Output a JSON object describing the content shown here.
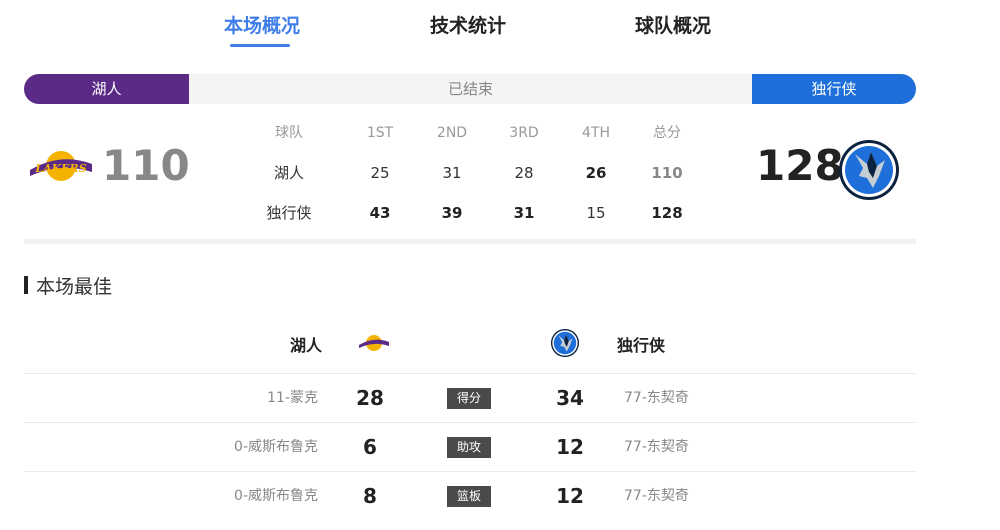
{
  "tabs": [
    {
      "label": "本场概况",
      "active": true
    },
    {
      "label": "技术统计",
      "active": false
    },
    {
      "label": "球队概况",
      "active": false
    }
  ],
  "status_bar": {
    "home_team": "湖人",
    "status": "已结束",
    "away_team": "独行侠",
    "home_color": "#5b2a86",
    "away_color": "#1e6fd9"
  },
  "score": {
    "home_score": "110",
    "away_score": "128",
    "home_logo": "lakers-logo",
    "away_logo": "mavericks-logo"
  },
  "quarters": {
    "headers": [
      "球队",
      "1ST",
      "2ND",
      "3RD",
      "4TH",
      "总分"
    ],
    "rows": [
      {
        "team": "湖人",
        "values": [
          "25",
          "31",
          "28",
          "26",
          "110"
        ]
      },
      {
        "team": "独行侠",
        "values": [
          "43",
          "39",
          "31",
          "15",
          "128"
        ]
      }
    ]
  },
  "best": {
    "title": "本场最佳",
    "home_team": "湖人",
    "away_team": "独行侠",
    "rows": [
      {
        "home_player": "11-蒙克",
        "home_value": "28",
        "category": "得分",
        "away_value": "34",
        "away_player": "77-东契奇"
      },
      {
        "home_player": "0-威斯布鲁克",
        "home_value": "6",
        "category": "助攻",
        "away_value": "12",
        "away_player": "77-东契奇"
      },
      {
        "home_player": "0-威斯布鲁克",
        "home_value": "8",
        "category": "篮板",
        "away_value": "12",
        "away_player": "77-东契奇"
      }
    ]
  }
}
